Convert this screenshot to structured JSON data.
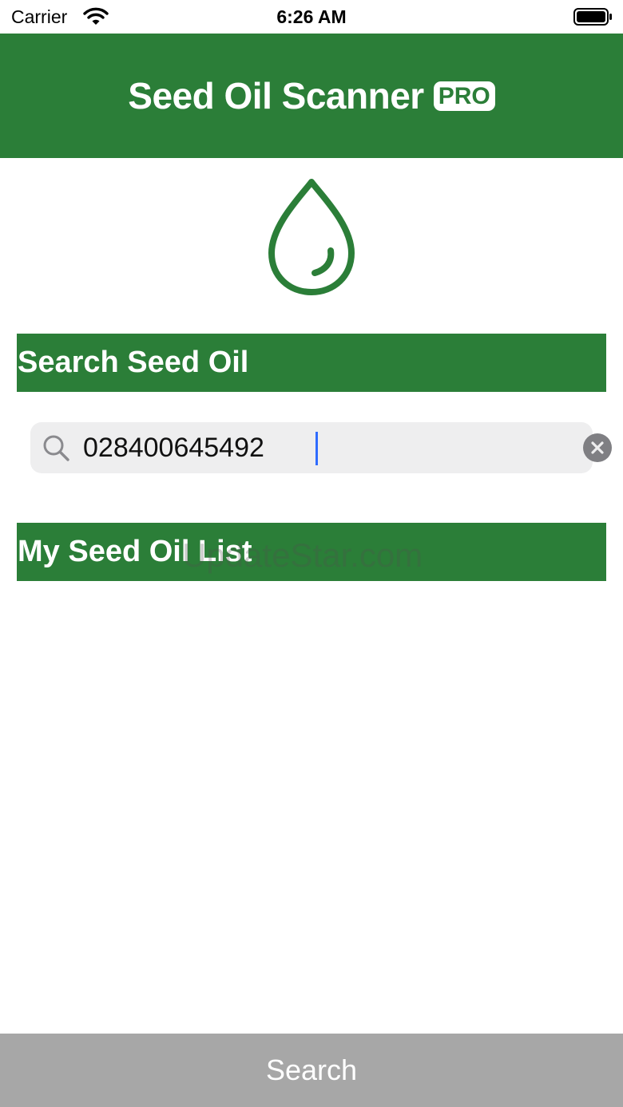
{
  "status_bar": {
    "carrier": "Carrier",
    "time": "6:26 AM",
    "wifi_icon": "wifi-icon",
    "battery_icon": "battery-icon"
  },
  "header": {
    "title": "Seed Oil Scanner",
    "badge": "PRO"
  },
  "logo": {
    "icon": "oil-drop-icon"
  },
  "search_section": {
    "title": "Search Seed Oil",
    "input_value": "028400645492",
    "search_icon": "magnifier-icon",
    "clear_icon": "clear-circle-icon"
  },
  "list_section": {
    "title": "My Seed Oil List"
  },
  "watermark": "UpdateStar.com",
  "bottom_button": {
    "label": "Search"
  },
  "colors": {
    "brand_green": "#2b7e38",
    "button_gray": "#a7a7a7",
    "field_bg": "#eeeeef",
    "caret_blue": "#2f6bff"
  }
}
